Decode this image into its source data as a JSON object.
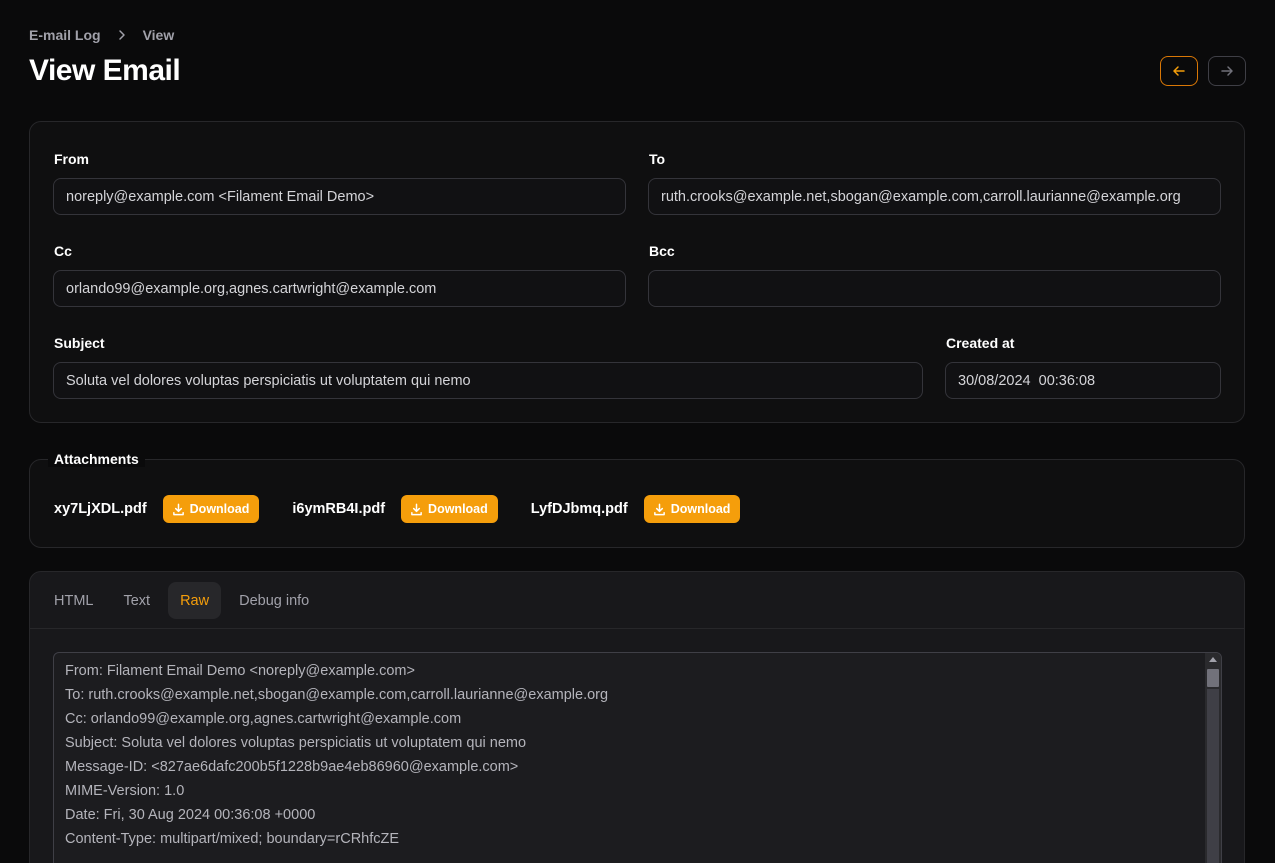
{
  "breadcrumb": {
    "parent": "E-mail Log",
    "current": "View"
  },
  "page": {
    "title": "View Email"
  },
  "fields": {
    "from": {
      "label": "From",
      "value": "noreply@example.com <Filament Email Demo>"
    },
    "to": {
      "label": "To",
      "value": "ruth.crooks@example.net,sbogan@example.com,carroll.laurianne@example.org"
    },
    "cc": {
      "label": "Cc",
      "value": "orlando99@example.org,agnes.cartwright@example.com"
    },
    "bcc": {
      "label": "Bcc",
      "value": ""
    },
    "subject": {
      "label": "Subject",
      "value": "Soluta vel dolores voluptas perspiciatis ut voluptatem qui nemo"
    },
    "created_at": {
      "label": "Created at",
      "value": "30/08/2024  00:36:08"
    }
  },
  "attachments": {
    "label": "Attachments",
    "items": [
      {
        "name": "xy7LjXDL.pdf",
        "button": "Download"
      },
      {
        "name": "i6ymRB4I.pdf",
        "button": "Download"
      },
      {
        "name": "LyfDJbmq.pdf",
        "button": "Download"
      }
    ]
  },
  "tabs": [
    {
      "label": "HTML"
    },
    {
      "label": "Text"
    },
    {
      "label": "Raw",
      "active": true
    },
    {
      "label": "Debug info"
    }
  ],
  "raw": {
    "lines": [
      "From: Filament Email Demo <noreply@example.com>",
      "To: ruth.crooks@example.net,sbogan@example.com,carroll.laurianne@example.org",
      "Cc: orlando99@example.org,agnes.cartwright@example.com",
      "Subject: Soluta vel dolores voluptas perspiciatis ut voluptatem qui nemo",
      "Message-ID: <827ae6dafc200b5f1228b9ae4eb86960@example.com>",
      "MIME-Version: 1.0",
      "Date: Fri, 30 Aug 2024 00:36:08 +0000",
      "Content-Type: multipart/mixed; boundary=rCRhfcZE"
    ]
  },
  "icons": {
    "breadcrumb_separator": "chevron-right-icon",
    "prev": "arrow-left-icon",
    "next": "arrow-right-icon",
    "download": "download-icon"
  },
  "colors": {
    "accent": "#f59e0b",
    "background": "#0a0a0b",
    "card": "#0f0f10"
  }
}
